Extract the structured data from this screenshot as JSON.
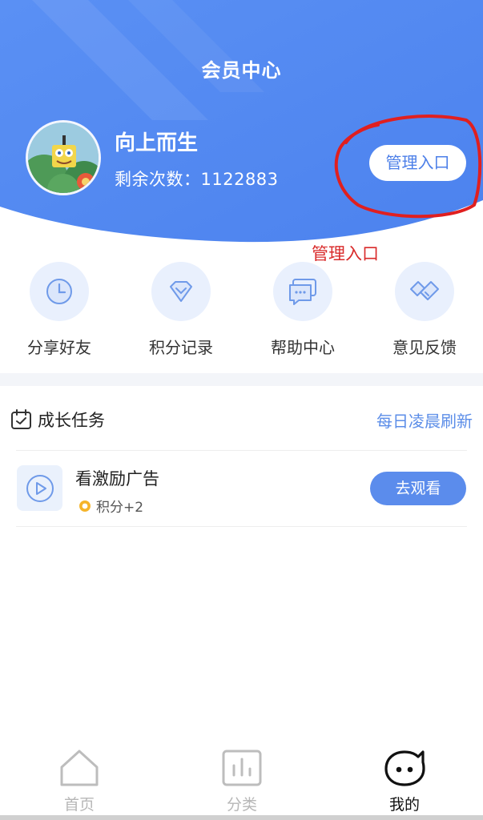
{
  "header": {
    "title": "会员中心",
    "username": "向上而生",
    "remaining_label": "剩余次数：",
    "remaining_count": "1122883",
    "admin_button": "管理入口",
    "annotation": "管理入口",
    "bg_color": "#4f86f1"
  },
  "quick_actions": [
    {
      "label": "分享好友",
      "icon": "clock-icon"
    },
    {
      "label": "积分记录",
      "icon": "diamond-icon"
    },
    {
      "label": "帮助中心",
      "icon": "chat-icon"
    },
    {
      "label": "意见反馈",
      "icon": "handshake-icon"
    }
  ],
  "tasks": {
    "title": "成长任务",
    "refresh_note": "每日凌晨刷新",
    "items": [
      {
        "name": "看激励广告",
        "points": "积分+2",
        "action": "去观看",
        "icon": "play-icon"
      }
    ]
  },
  "bottom_nav": [
    {
      "label": "首页",
      "icon": "home-icon",
      "active": false
    },
    {
      "label": "分类",
      "icon": "chart-icon",
      "active": false
    },
    {
      "label": "我的",
      "icon": "face-icon",
      "active": true
    }
  ],
  "colors": {
    "accent": "#5b8cec",
    "annotation": "#d92b2b"
  }
}
